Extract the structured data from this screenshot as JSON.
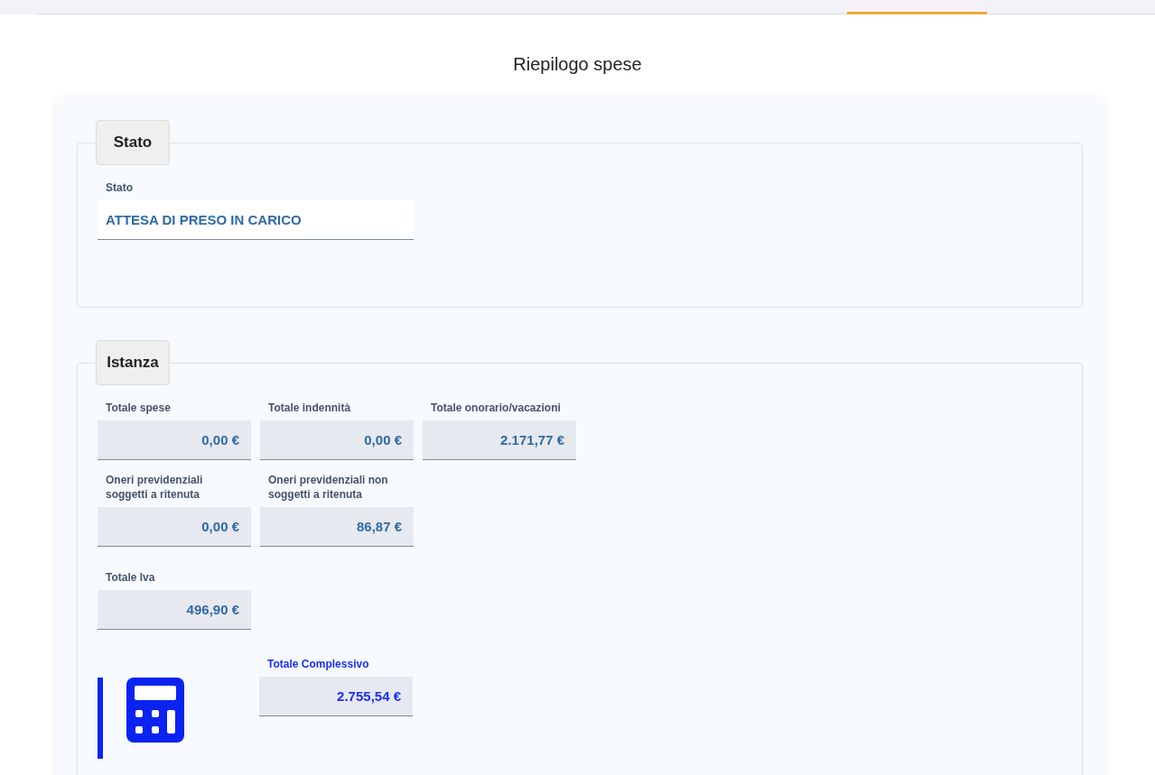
{
  "page_title": "Riepilogo spese",
  "status_section": {
    "legend": "Stato",
    "field": {
      "label": "Stato",
      "value": "ATTESA DI PRESO IN CARICO"
    }
  },
  "instance_section": {
    "legend": "Istanza",
    "rows": [
      [
        {
          "label": "Totale spese",
          "value": "0,00 €"
        },
        {
          "label": "Totale indennità",
          "value": "0,00 €"
        },
        {
          "label": "Totale onorario/vacazioni",
          "value": "2.171,77 €"
        }
      ],
      [
        {
          "label": "Oneri previdenziali soggetti a ritenuta",
          "value": "0,00 €"
        },
        {
          "label": "Oneri previdenziali non soggetti a ritenuta",
          "value": "86,87 €"
        }
      ],
      [
        {
          "label": "Totale Iva",
          "value": "496,90 €"
        }
      ]
    ],
    "total": {
      "label": "Totale Complessivo",
      "value": "2.755,54 €"
    }
  }
}
